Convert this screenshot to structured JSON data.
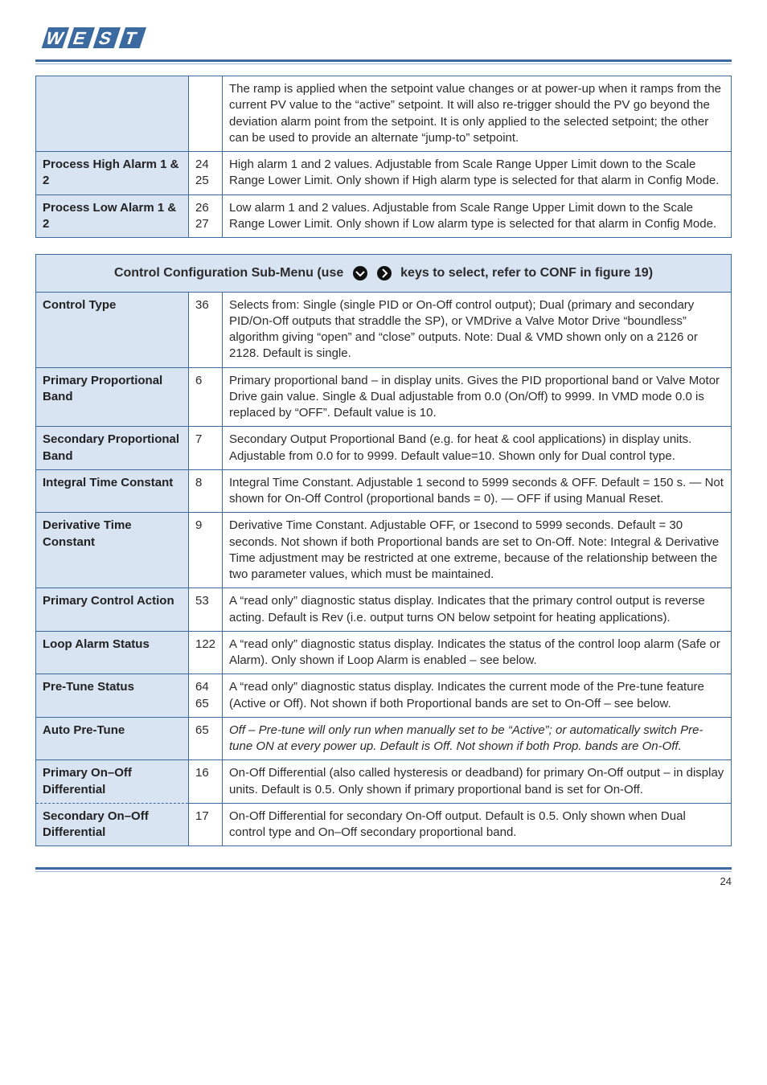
{
  "brand": {
    "name": "WEST"
  },
  "table1": {
    "rows": [
      {
        "param": "",
        "mid": "",
        "desc": "The ramp is applied when the setpoint value changes or at power-up when it ramps from the current PV value to the “active” setpoint. It will also re-trigger should the PV go beyond the deviation alarm point from the setpoint. It is only applied to the selected setpoint; the other can be used to provide an alternate “jump-to” setpoint."
      },
      {
        "param": "Process High Alarm 1 & 2",
        "mid": "24 25",
        "desc": "High alarm 1 and 2 values. Adjustable from Scale Range Upper Limit down to the Scale Range Lower Limit. Only shown if High alarm type is selected for that alarm in Config Mode."
      },
      {
        "param": "Process Low Alarm 1 & 2",
        "mid": "26 27",
        "desc": "Low alarm 1 and 2 values. Adjustable from Scale Range Upper Limit down to the Scale Range Lower Limit. Only shown if Low alarm type is selected for that alarm in Config Mode."
      }
    ]
  },
  "menuHeader": {
    "before": "Control Configuration Sub-Menu (use",
    "after": "keys to select, refer to CONF in figure 19)"
  },
  "table2": {
    "rows": [
      {
        "param": "Control Type",
        "mid": "36",
        "desc": "Selects from: Single (single PID or On-Off control output); Dual (primary and secondary PID/On-Off outputs that straddle the SP), or VMDrive a Valve Motor Drive “boundless” algorithm giving “open” and “close” outputs. Note: Dual & VMD shown only on a 2126 or 2128. Default is single."
      },
      {
        "param": "Primary Proportional Band",
        "mid": "6",
        "desc": "Primary proportional band – in display units. Gives the PID proportional band or Valve Motor Drive gain value. Single & Dual adjustable from 0.0 (On/Off) to 9999. In VMD mode 0.0 is replaced by “OFF”. Default value is 10."
      },
      {
        "param": "Secondary Proportional Band",
        "mid": "7",
        "desc": "Secondary Output Proportional Band (e.g. for heat & cool applications) in display units. Adjustable from 0.0 for to 9999. Default value=10. Shown only for Dual control type."
      },
      {
        "param": "Integral Time Constant",
        "mid": "8",
        "desc": "Integral Time Constant. Adjustable 1 second to 5999 seconds & OFF. Default = 150 s. — Not shown for On-Off Control (proportional bands = 0). — OFF if using Manual Reset."
      },
      {
        "param": "Derivative Time Constant",
        "mid": "9",
        "desc": "Derivative Time Constant. Adjustable OFF, or 1second to 5999 seconds. Default = 30 seconds. Not shown if both Proportional bands are set to On-Off.                       Note: Integral & Derivative Time adjustment may be restricted at one extreme, because of the relationship between the two parameter values, which must be maintained."
      },
      {
        "param": "Primary Control Action",
        "mid": "53",
        "desc": "A “read only” diagnostic status display. Indicates that the primary control output is reverse acting. Default is Rev (i.e. output turns ON below setpoint for heating applications)."
      },
      {
        "param": "Loop Alarm Status",
        "mid": "122",
        "desc": "A “read only” diagnostic status display. Indicates the status of the control loop alarm (Safe or Alarm). Only shown if Loop Alarm is enabled – see below."
      },
      {
        "param": "Pre-Tune Status",
        "mid": "64 65",
        "desc": "A “read only” diagnostic status display. Indicates the current mode of the Pre-tune feature (Active or Off). Not shown if both Proportional bands are set to On-Off – see below."
      },
      {
        "param": "Auto Pre-Tune",
        "mid": "65",
        "desc": "Off – Pre-tune will only run when manually set to be “Active”; or automatically switch Pre-tune ON at every power up. Default is Off. Not shown if both Prop. bands are On-Off."
      },
      {
        "param": "Primary On–Off Differential",
        "mid": "16",
        "desc": "On-Off Differential (also called hysteresis or deadband) for primary On-Off output – in display units. Default is 0.5. Only shown if primary proportional band is set for On-Off."
      },
      {
        "param": "Secondary On–Off Differential",
        "mid": "17",
        "desc": "On-Off Differential for secondary On-Off output. Default is 0.5. Only shown when Dual control type and On–Off secondary proportional band."
      }
    ]
  },
  "page": "24"
}
